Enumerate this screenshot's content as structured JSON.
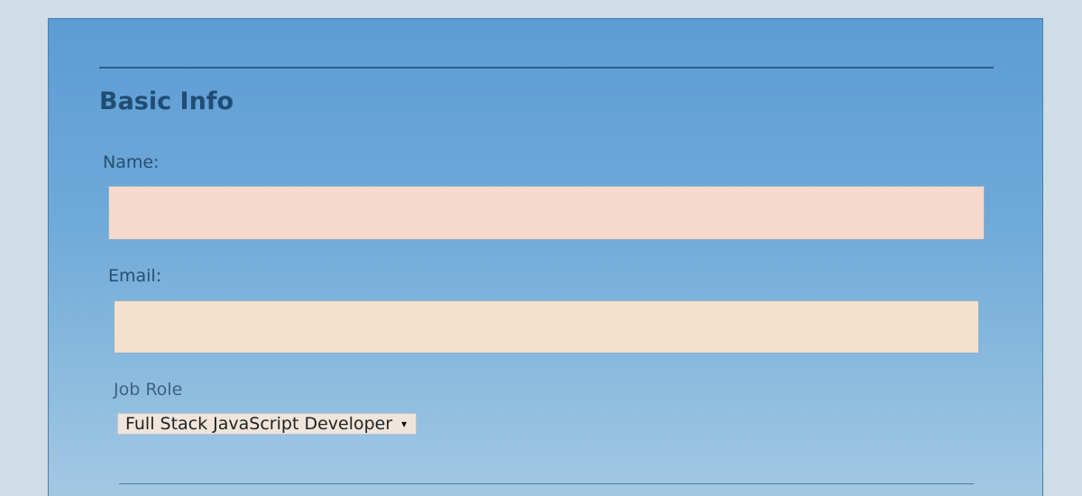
{
  "form": {
    "section_title": "Basic Info",
    "name": {
      "label": "Name:",
      "value": "",
      "placeholder": ""
    },
    "email": {
      "label": "Email:",
      "value": "",
      "placeholder": ""
    },
    "job_role": {
      "label": "Job Role",
      "selected": "Full Stack JavaScript Developer",
      "arrow_icon": "▾"
    }
  },
  "colors": {
    "panel": "#6ea9d8",
    "heading": "#1f4d74",
    "input_bg": "#f4d9cc"
  }
}
